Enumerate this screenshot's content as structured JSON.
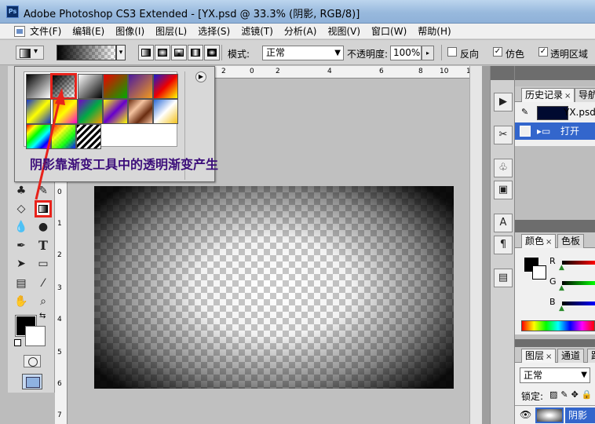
{
  "window": {
    "title": "Adobe Photoshop CS3 Extended - [YX.psd @ 33.3% (阴影, RGB/8)]",
    "app_badge": "Ps"
  },
  "menu": [
    "文件(F)",
    "编辑(E)",
    "图像(I)",
    "图层(L)",
    "选择(S)",
    "滤镜(T)",
    "分析(A)",
    "视图(V)",
    "窗口(W)",
    "帮助(H)"
  ],
  "options": {
    "mode_label": "模式:",
    "mode_value": "正常",
    "opacity_label": "不透明度:",
    "opacity_value": "100%",
    "reverse_label": "反向",
    "reverse_checked": false,
    "dither_label": "仿色",
    "dither_checked": true,
    "transparency_label": "透明区域",
    "transparency_checked": true
  },
  "annotation": "阴影靠渐变工具中的透明渐变产生",
  "rulers": {
    "top": [
      "2",
      "0",
      "2",
      "4",
      "6",
      "8",
      "10",
      "12"
    ],
    "left": [
      "0",
      "1",
      "2",
      "3",
      "4",
      "5",
      "6",
      "7"
    ]
  },
  "panels": {
    "history_tab": "历史记录",
    "navigator_tab": "导航",
    "snapshot_name": "YX.psd",
    "history_state": "打开",
    "color_tab": "颜色",
    "swatches_tab": "色板",
    "channel_r": "R",
    "channel_g": "G",
    "channel_b": "B",
    "layers_tab": "图层",
    "channels_tab": "通道",
    "paths_tab": "路",
    "blend_mode": "正常",
    "lock_label": "锁定:",
    "layer_name": "阴影"
  },
  "colors": {
    "accent_red": "#e8221b",
    "annotation_purple": "#3b0d7a",
    "selection_blue": "#3366cc"
  }
}
